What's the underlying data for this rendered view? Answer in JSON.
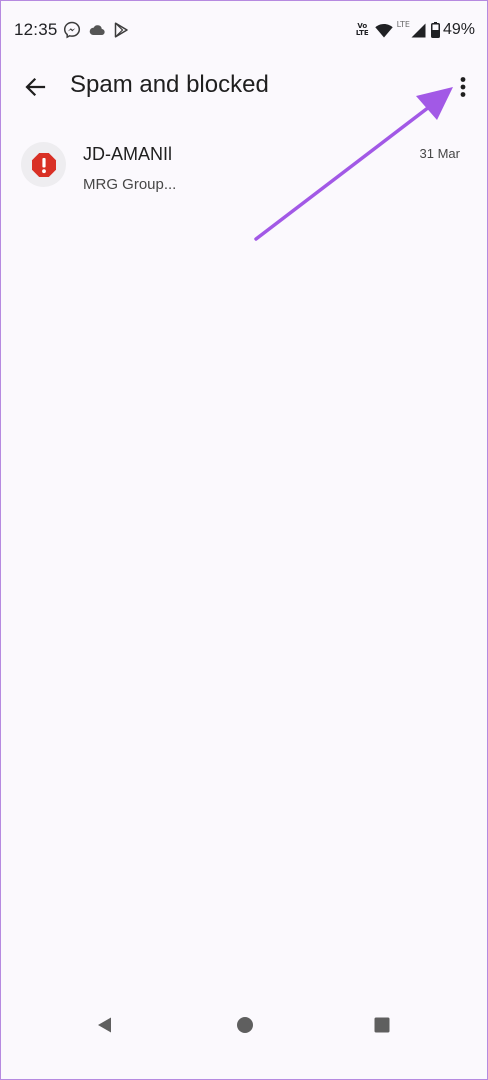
{
  "status_bar": {
    "time": "12:35",
    "notification_icons": [
      "messenger-icon",
      "cloud-icon",
      "play-store-icon"
    ],
    "volte_line1": "Vo",
    "volte_line2": "LTE",
    "lte_label": "LTE",
    "battery_percent": "49%"
  },
  "app_bar": {
    "title": "Spam and blocked",
    "back_icon": "arrow-back-icon",
    "more_icon": "more-vert-icon"
  },
  "conversations": [
    {
      "sender": "JD-AMANIl",
      "snippet": "MRG Group...",
      "date": "31 Mar",
      "avatar_icon": "spam-alert-icon"
    }
  ],
  "colors": {
    "background": "#fbf9fd",
    "spam_red": "#d93025",
    "annotation_purple": "#a259e6",
    "frame_border": "#b68ae0"
  },
  "nav_bar": {
    "icons": [
      "back-triangle-icon",
      "home-circle-icon",
      "recents-square-icon"
    ]
  }
}
